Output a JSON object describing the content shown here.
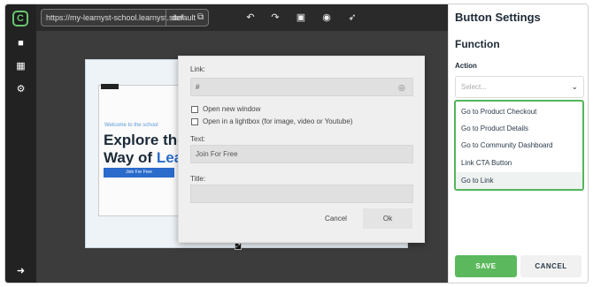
{
  "topbar": {
    "url": "https://my-learnyst-school.learnyst.site/",
    "mode": "default"
  },
  "preview": {
    "welcome": "Welcome to the school",
    "headline_line1": "Explore the",
    "headline_line2a": "Way of ",
    "headline_line2b": "Lear",
    "cta": "Join For Free"
  },
  "dialog": {
    "link_label": "Link:",
    "link_value": "#",
    "open_new_window": "Open new window",
    "open_lightbox": "Open in a lightbox (for image, video or Youtube)",
    "text_label": "Text:",
    "text_value": "Join For Free",
    "title_label": "Title:",
    "title_value": "",
    "cancel": "Cancel",
    "ok": "Ok"
  },
  "panel": {
    "title": "Button Settings",
    "section": "Function",
    "action_label": "Action",
    "select_placeholder": "Select...",
    "options": [
      {
        "label": "Go to Product Checkout"
      },
      {
        "label": "Go to Product Details"
      },
      {
        "label": "Go to Community Dashboard"
      },
      {
        "label": "Link CTA Button"
      },
      {
        "label": "Go to Link"
      }
    ],
    "save": "SAVE",
    "cancel": "CANCEL"
  },
  "colors": {
    "accent_green": "#5cb85c",
    "preview_blue": "#2a6bcc"
  },
  "icons": [
    "logo-icon",
    "add-icon",
    "grid-icon",
    "gear-icon",
    "exit-icon",
    "copy-icon",
    "undo-icon",
    "redo-icon",
    "save-icon",
    "preview-eye-icon",
    "rocket-icon",
    "chevron-down-icon",
    "eye-icon"
  ]
}
